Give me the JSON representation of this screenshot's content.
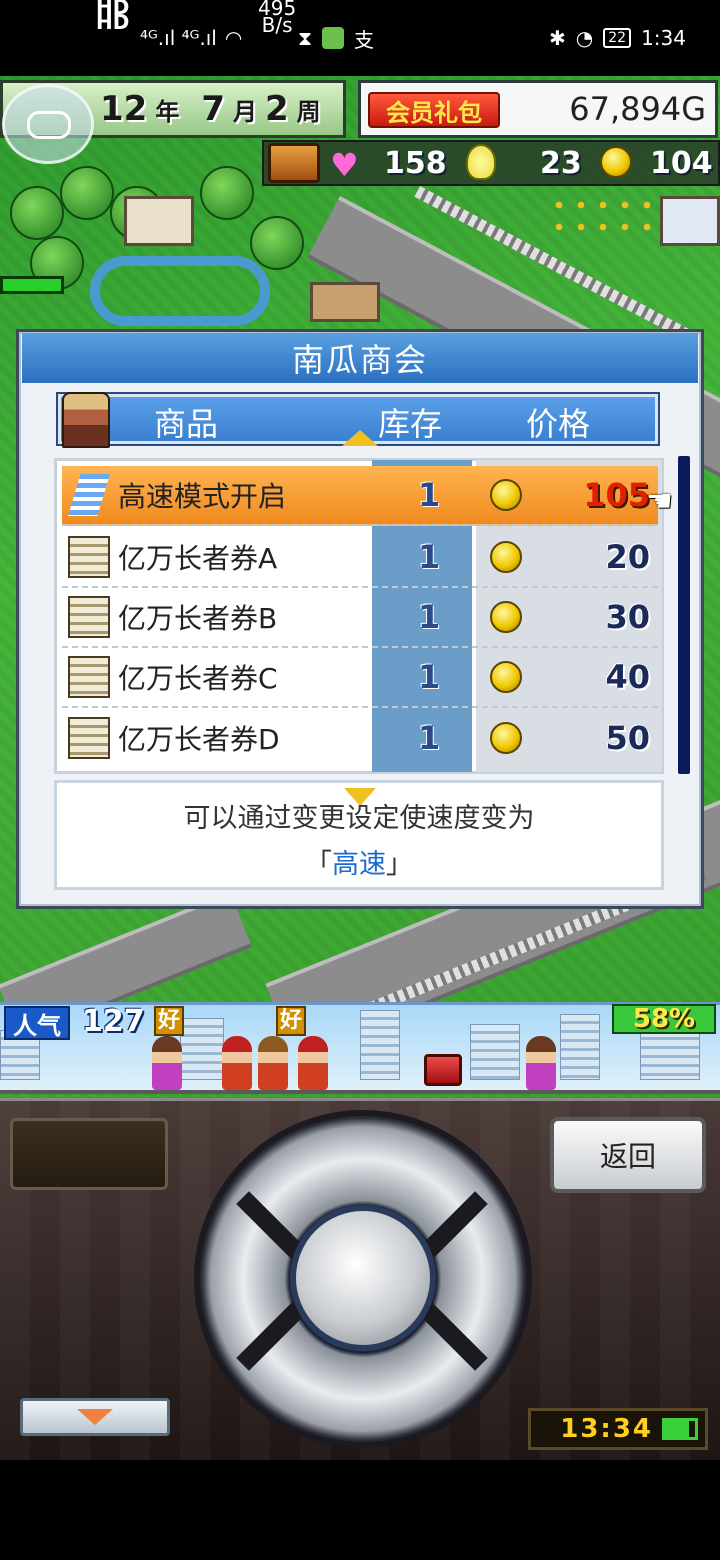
{
  "status_bar": {
    "hd1": "HD",
    "hd2": "HD",
    "signal": "⁴ᴳ.ıl ⁴ᴳ.ıl",
    "speed_value": "495",
    "speed_unit": "B/s",
    "bluetooth": "✱",
    "battery": "22",
    "time": "1:34"
  },
  "hud": {
    "year_num": "12",
    "year_unit": "年",
    "month_num": "7",
    "month_unit": "月",
    "week_num": "2",
    "week_unit": "周",
    "member_gift": "会员礼包",
    "money": "67,894G",
    "hearts": "158",
    "ideas": "23",
    "coins": "104"
  },
  "shop": {
    "title": "南瓜商会",
    "col_item": "商品",
    "col_stock": "库存",
    "col_price": "价格",
    "items": [
      {
        "name": "高速模式开启",
        "stock": "1",
        "price": "105",
        "icon": "speed-icon",
        "selected": true
      },
      {
        "name": "亿万长者券A",
        "stock": "1",
        "price": "20",
        "icon": "ticket-icon",
        "selected": false
      },
      {
        "name": "亿万长者券B",
        "stock": "1",
        "price": "30",
        "icon": "ticket-icon",
        "selected": false
      },
      {
        "name": "亿万长者券C",
        "stock": "1",
        "price": "40",
        "icon": "ticket-icon",
        "selected": false
      },
      {
        "name": "亿万长者券D",
        "stock": "1",
        "price": "50",
        "icon": "ticket-icon",
        "selected": false
      }
    ],
    "description_line1": "可以通过变更设定使速度变为",
    "description_open": "「",
    "description_highlight": "高速",
    "description_close": "」"
  },
  "popularity": {
    "label": "人气",
    "value": "127",
    "good1": "好",
    "good2": "好",
    "percent": "58%"
  },
  "controls": {
    "back_label": "返回",
    "clock": "13:34"
  },
  "colors": {
    "selected_row": "#f08a20",
    "title_blue": "#2a70c0",
    "price_red": "#e02000"
  }
}
